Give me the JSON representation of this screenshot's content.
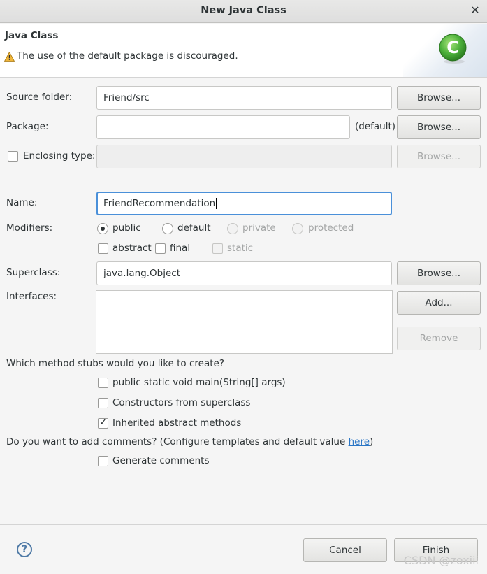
{
  "window": {
    "title": "New Java Class",
    "close_glyph": "✕"
  },
  "header": {
    "title": "Java Class",
    "message": "The use of the default package is discouraged.",
    "logo_letter": "C"
  },
  "source_folder": {
    "label": "Source folder:",
    "value": "Friend/src",
    "browse": "Browse..."
  },
  "package": {
    "label": "Package:",
    "value": "",
    "hint": "(default)",
    "browse": "Browse..."
  },
  "enclosing": {
    "label": "Enclosing type:",
    "value": "",
    "browse": "Browse...",
    "checked": false
  },
  "name": {
    "label": "Name:",
    "value": "FriendRecommendation"
  },
  "modifiers": {
    "label": "Modifiers:",
    "radios": [
      {
        "label": "public",
        "selected": true,
        "enabled": true
      },
      {
        "label": "default",
        "selected": false,
        "enabled": true
      },
      {
        "label": "private",
        "selected": false,
        "enabled": false
      },
      {
        "label": "protected",
        "selected": false,
        "enabled": false
      }
    ],
    "checks": [
      {
        "label": "abstract",
        "checked": false,
        "enabled": true
      },
      {
        "label": "final",
        "checked": false,
        "enabled": true
      },
      {
        "label": "static",
        "checked": false,
        "enabled": false
      }
    ]
  },
  "superclass": {
    "label": "Superclass:",
    "value": "java.lang.Object",
    "browse": "Browse..."
  },
  "interfaces": {
    "label": "Interfaces:",
    "add": "Add...",
    "remove": "Remove",
    "items": []
  },
  "stubs": {
    "question": "Which method stubs would you like to create?",
    "options": [
      {
        "label": "public static void main(String[] args)",
        "checked": false
      },
      {
        "label": "Constructors from superclass",
        "checked": false
      },
      {
        "label": "Inherited abstract methods",
        "checked": true
      }
    ]
  },
  "comments": {
    "question_prefix": "Do you want to add comments? (Configure templates and default value ",
    "link": "here",
    "question_suffix": ")",
    "option": "Generate comments",
    "checked": false
  },
  "footer": {
    "help_glyph": "?",
    "cancel": "Cancel",
    "finish": "Finish"
  },
  "watermark": "CSDN @zoxiii"
}
